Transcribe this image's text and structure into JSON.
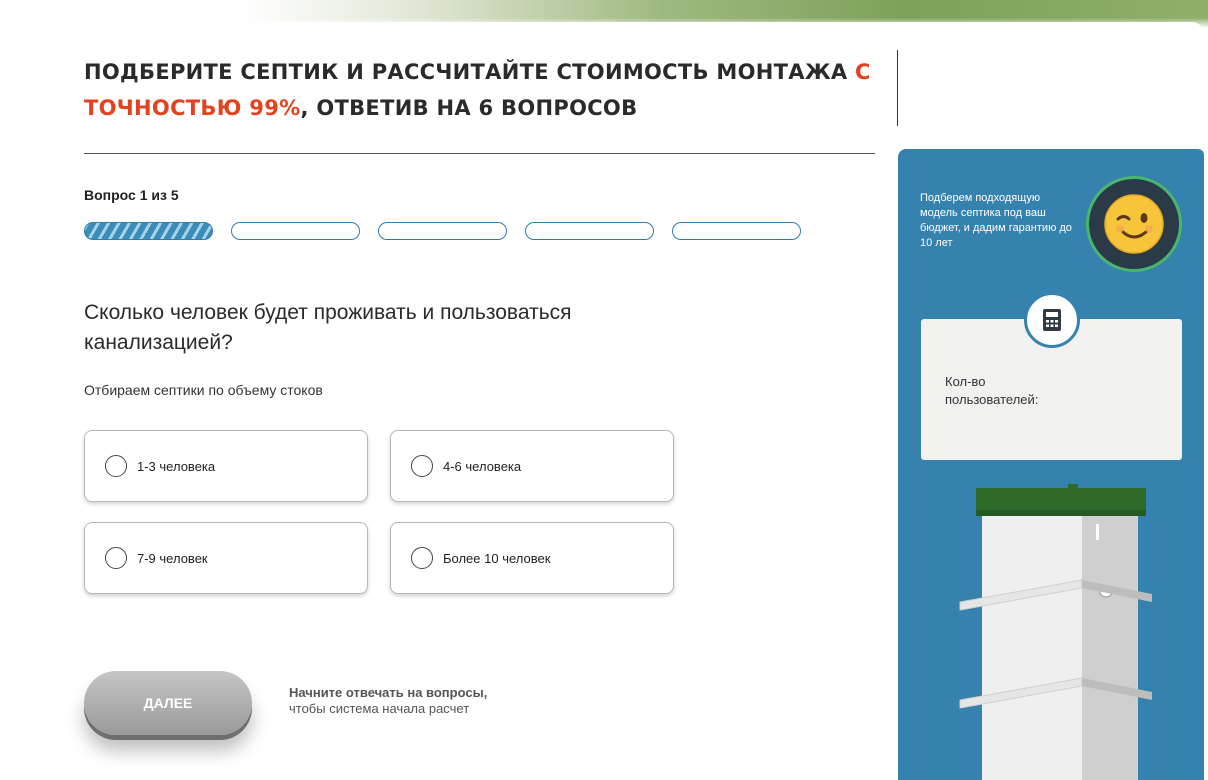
{
  "headline": {
    "part1": "ПОДБЕРИТЕ СЕПТИК И РАССЧИТАЙТЕ СТОИМОСТЬ МОНТАЖА ",
    "accent": "С ТОЧНОСТЬЮ 99%",
    "part2": ", ОТВЕТИВ НА 6 ВОПРОСОВ"
  },
  "progress": {
    "label": "Вопрос 1 из 5",
    "current": 1,
    "total": 5
  },
  "question": {
    "title": "Сколько человек будет проживать и пользоваться канализацией?",
    "hint": "Отбираем септики по объему стоков"
  },
  "options": [
    {
      "label": "1-3 человека"
    },
    {
      "label": "4-6 человека"
    },
    {
      "label": "7-9 человек"
    },
    {
      "label": "Более 10 человек"
    }
  ],
  "next": {
    "button": "ДАЛЕЕ",
    "hint_bold": "Начните отвечать на вопросы,",
    "hint_rest": "чтобы система начала расчет"
  },
  "sidebar": {
    "promo": "Подберем подходящую модель септика под ваш бюджет, и дадим гарантию до 10 лет",
    "result_label": "Кол-во пользователей:",
    "avatar_icon": "winking-face-icon",
    "calc_icon": "calculator-icon"
  },
  "colors": {
    "accent": "#e4421f",
    "panel": "#3682ae",
    "tank_lid": "#2e6b2a"
  }
}
